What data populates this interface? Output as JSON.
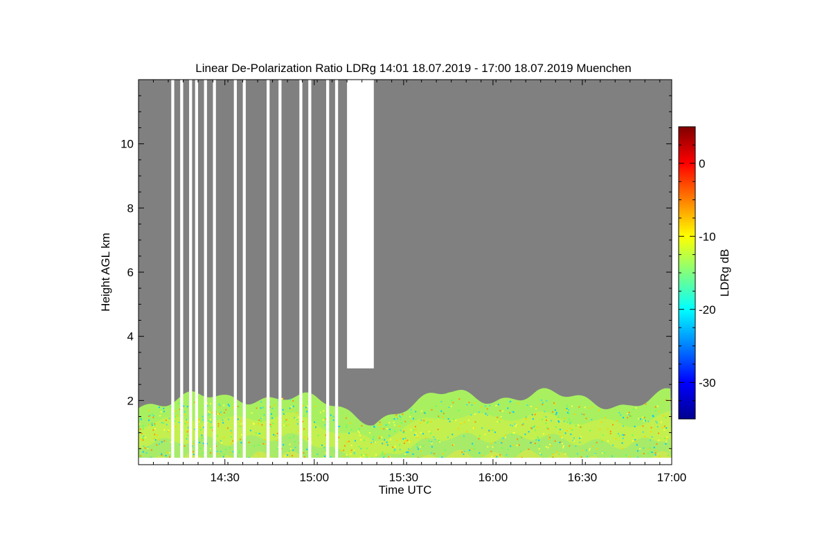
{
  "chart_data": {
    "type": "heatmap",
    "title": "Linear De-Polarization Ratio LDRg   14:01 18.07.2019 - 17:00 18.07.2019 Muenchen",
    "xlabel": "Time UTC",
    "ylabel": "Height AGL km",
    "xlim": [
      "14:01",
      "17:00"
    ],
    "ylim": [
      0,
      12
    ],
    "x_ticks": [
      "14:30",
      "15:00",
      "15:30",
      "16:00",
      "16:30",
      "17:00"
    ],
    "y_ticks": [
      2,
      4,
      6,
      8,
      10
    ],
    "colorbar": {
      "label": "LDRg dB",
      "range": [
        -35,
        5
      ],
      "ticks": [
        0,
        -10,
        -20,
        -30
      ],
      "colormap": "jet"
    },
    "background_color": "#808080",
    "layer": {
      "description_values": "depolarization ratio mostly -10 to -18 dB in boundary layer",
      "top_height_km": [
        [
          "14:01",
          1.9
        ],
        [
          "14:10",
          2.0
        ],
        [
          "14:20",
          2.1
        ],
        [
          "14:30",
          2.0
        ],
        [
          "14:40",
          2.1
        ],
        [
          "14:50",
          2.2
        ],
        [
          "15:00",
          2.0
        ],
        [
          "15:10",
          1.6
        ],
        [
          "15:20",
          1.4
        ],
        [
          "15:30",
          1.8
        ],
        [
          "15:45",
          2.2
        ],
        [
          "16:00",
          2.1
        ],
        [
          "16:15",
          2.2
        ],
        [
          "16:30",
          2.0
        ],
        [
          "16:45",
          1.9
        ],
        [
          "17:00",
          2.2
        ]
      ]
    },
    "missing_data_gaps": [
      [
        "14:12",
        "14:13"
      ],
      [
        "14:15",
        "14:16"
      ],
      [
        "14:18",
        "14:19"
      ],
      [
        "14:20",
        "14:21"
      ],
      [
        "14:23",
        "14:24"
      ],
      [
        "14:26",
        "14:27"
      ],
      [
        "14:33",
        "14:34"
      ],
      [
        "14:36",
        "14:37"
      ],
      [
        "14:44",
        "14:45"
      ],
      [
        "14:48",
        "14:49"
      ],
      [
        "14:55",
        "14:56"
      ],
      [
        "14:58",
        "14:59"
      ],
      [
        "15:04",
        "15:05"
      ],
      [
        "15:07",
        "15:08"
      ],
      [
        "15:11",
        "15:20"
      ]
    ]
  }
}
